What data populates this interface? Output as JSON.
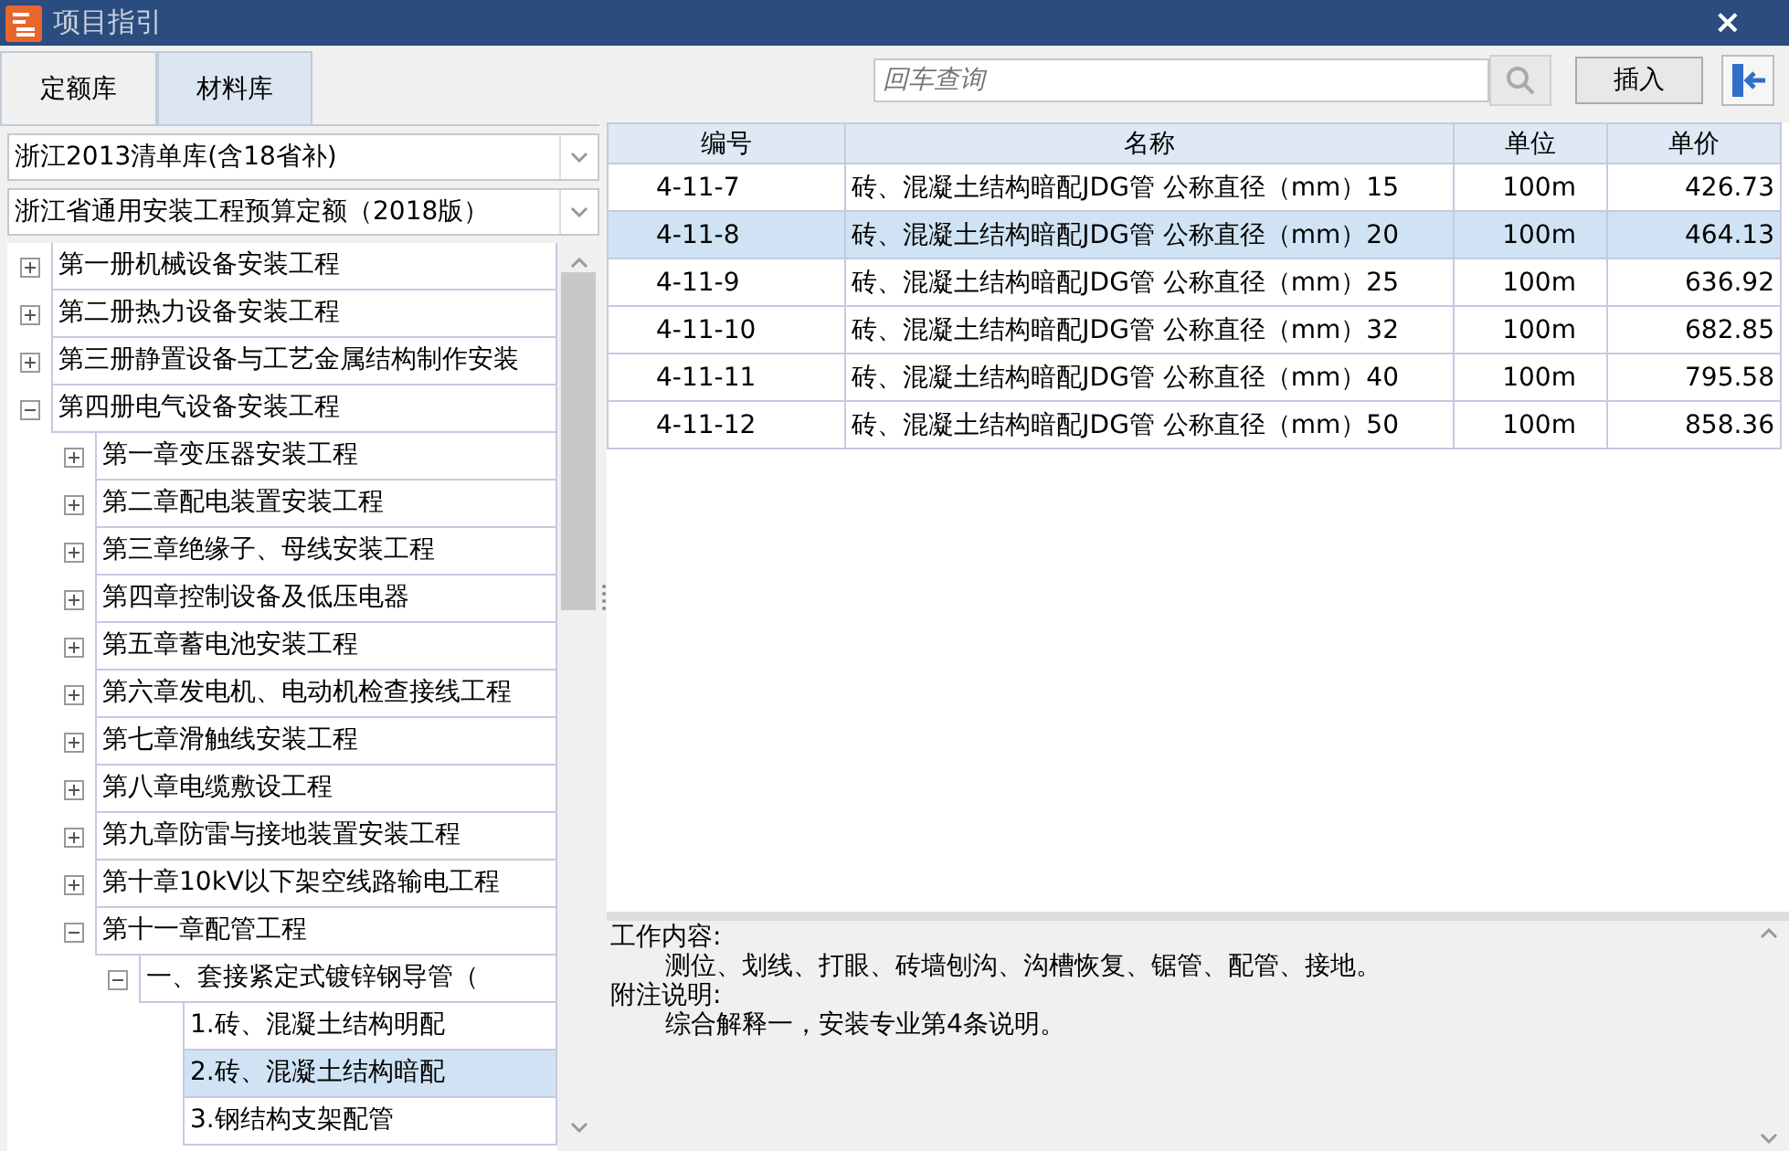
{
  "window": {
    "title": "项目指引",
    "close": "×"
  },
  "tabs": [
    {
      "label": "定额库",
      "selected": true
    },
    {
      "label": "材料库",
      "selected": false
    }
  ],
  "library_select": {
    "value": "浙江2013清单库(含18省补)"
  },
  "quota_select": {
    "value": "浙江省通用安装工程预算定额（2018版）"
  },
  "tree": [
    {
      "label": "第一册机械设备安装工程",
      "expanded": false,
      "selected": false
    },
    {
      "label": "第二册热力设备安装工程",
      "expanded": false,
      "selected": false
    },
    {
      "label": "第三册静置设备与工艺金属结构制作安装",
      "expanded": false,
      "selected": false
    },
    {
      "label": "第四册电气设备安装工程",
      "expanded": true,
      "selected": false,
      "children": [
        {
          "label": "第一章变压器安装工程",
          "expanded": false,
          "selected": false
        },
        {
          "label": "第二章配电装置安装工程",
          "expanded": false,
          "selected": false
        },
        {
          "label": "第三章绝缘子、母线安装工程",
          "expanded": false,
          "selected": false
        },
        {
          "label": "第四章控制设备及低压电器",
          "expanded": false,
          "selected": false
        },
        {
          "label": "第五章蓄电池安装工程",
          "expanded": false,
          "selected": false
        },
        {
          "label": "第六章发电机、电动机检查接线工程",
          "expanded": false,
          "selected": false
        },
        {
          "label": "第七章滑触线安装工程",
          "expanded": false,
          "selected": false
        },
        {
          "label": "第八章电缆敷设工程",
          "expanded": false,
          "selected": false
        },
        {
          "label": "第九章防雷与接地装置安装工程",
          "expanded": false,
          "selected": false
        },
        {
          "label": "第十章10kV以下架空线路输电工程",
          "expanded": false,
          "selected": false
        },
        {
          "label": "第十一章配管工程",
          "expanded": true,
          "selected": false,
          "children": [
            {
              "label": "一、套接紧定式镀锌钢导管（",
              "expanded": true,
              "selected": false,
              "children": [
                {
                  "label": "1.砖、混凝土结构明配",
                  "selected": false
                },
                {
                  "label": "2.砖、混凝土结构暗配",
                  "selected": true
                },
                {
                  "label": "3.钢结构支架配管",
                  "selected": false
                }
              ]
            }
          ]
        }
      ]
    }
  ],
  "search": {
    "placeholder": "回车查询"
  },
  "insert_button": "插入",
  "table": {
    "columns": [
      "编号",
      "名称",
      "单位",
      "单价"
    ],
    "rows": [
      {
        "code": "4-11-7",
        "name": "砖、混凝土结构暗配JDG管 公称直径（mm）15",
        "unit": "100m",
        "price": "426.73",
        "selected": false
      },
      {
        "code": "4-11-8",
        "name": "砖、混凝土结构暗配JDG管 公称直径（mm）20",
        "unit": "100m",
        "price": "464.13",
        "selected": true
      },
      {
        "code": "4-11-9",
        "name": "砖、混凝土结构暗配JDG管 公称直径（mm）25",
        "unit": "100m",
        "price": "636.92",
        "selected": false
      },
      {
        "code": "4-11-10",
        "name": "砖、混凝土结构暗配JDG管 公称直径（mm）32",
        "unit": "100m",
        "price": "682.85",
        "selected": false
      },
      {
        "code": "4-11-11",
        "name": "砖、混凝土结构暗配JDG管 公称直径（mm）40",
        "unit": "100m",
        "price": "795.58",
        "selected": false
      },
      {
        "code": "4-11-12",
        "name": "砖、混凝土结构暗配JDG管 公称直径（mm）50",
        "unit": "100m",
        "price": "858.36",
        "selected": false
      }
    ]
  },
  "notes": [
    {
      "heading": "工作内容:",
      "body": "测位、划线、打眼、砖墙刨沟、沟槽恢复、锯管、配管、接地。"
    },
    {
      "heading": "附注说明:",
      "body": "综合解释一，安装专业第4条说明。"
    }
  ]
}
